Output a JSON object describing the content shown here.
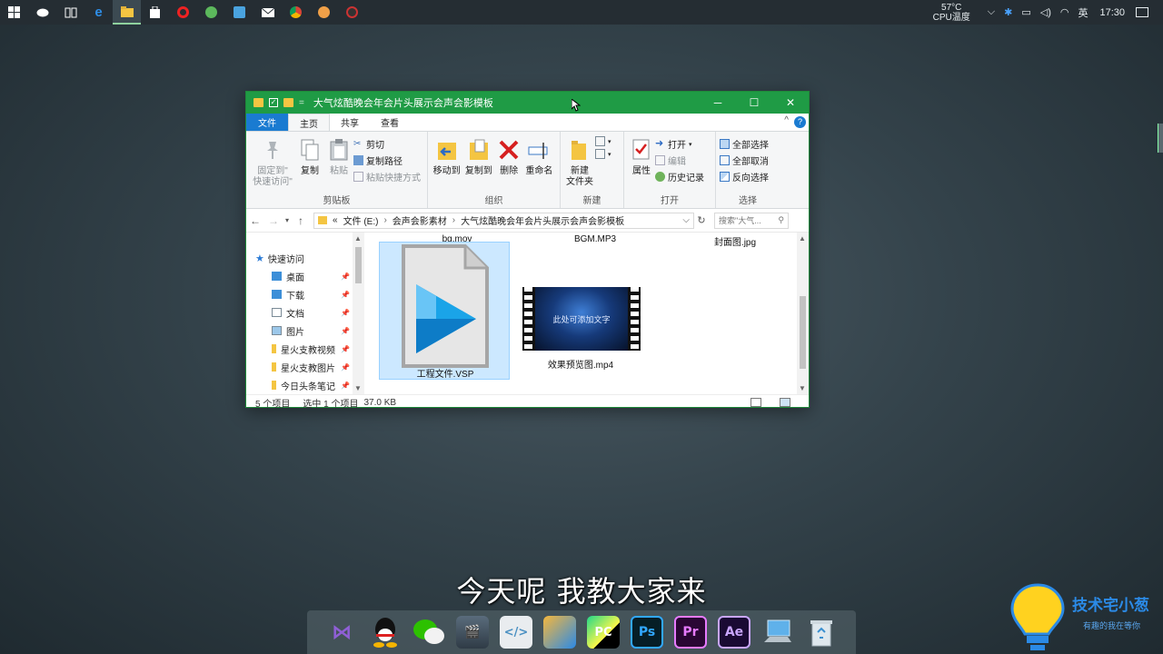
{
  "taskbar": {
    "tray": {
      "temperature": "57°C",
      "temperature_label": "CPU温度",
      "ime": "英",
      "time": "17:30"
    }
  },
  "window": {
    "title": "大气炫酷晚会年会片头展示会声会影模板",
    "ribbon_tabs": [
      "文件",
      "主页",
      "共享",
      "查看"
    ],
    "clipboard": {
      "pin_label_1": "固定到\"",
      "pin_label_2": "快速访问\"",
      "copy": "复制",
      "paste": "粘贴",
      "cut": "剪切",
      "copy_path": "复制路径",
      "paste_shortcut": "粘贴快捷方式",
      "group": "剪贴板"
    },
    "organize": {
      "move_to": "移动到",
      "copy_to": "复制到",
      "delete": "删除",
      "rename": "重命名",
      "group": "组织"
    },
    "new": {
      "new_folder_1": "新建",
      "new_folder_2": "文件夹",
      "group": "新建"
    },
    "open": {
      "properties": "属性",
      "open": "打开",
      "edit": "编辑",
      "history": "历史记录",
      "group": "打开"
    },
    "select": {
      "select_all": "全部选择",
      "select_none": "全部取消",
      "invert": "反向选择",
      "group": "选择"
    },
    "address": {
      "crumbs": [
        "文件 (E:)",
        "会声会影素材",
        "大气炫酷晚会年会片头展示会声会影模板"
      ],
      "overflow": "«",
      "search_placeholder": "搜索\"大气..."
    },
    "nav_pane": {
      "quick_access": "快速访问",
      "items": [
        "桌面",
        "下载",
        "文档",
        "图片",
        "星火支教视频",
        "星火支教图片",
        "今日头条笔记"
      ]
    },
    "files": {
      "top_row": [
        "bg.mov",
        "BGM.MP3",
        "封面图.jpg"
      ],
      "project_file": "工程文件.VSP",
      "preview_file": "效果预览图.mp4",
      "thumbnail_text": "此处可添加文字"
    },
    "status": {
      "count": "5 个项目",
      "selection": "选中 1 个项目",
      "size": "37.0 KB"
    }
  },
  "subtitle": "今天呢 我教大家来",
  "dock": {
    "apps": [
      "VS",
      "QQ",
      "WeChat",
      "Clapper",
      "Code",
      "Files",
      "PC",
      "Ps",
      "Pr",
      "Ae",
      "PC",
      "Bin"
    ]
  },
  "watermark": {
    "title": "技术宅小葱",
    "subtitle": "有趣的我在等你"
  },
  "colors": {
    "titlebar": "#1f9b45",
    "accent": "#1a7bd1",
    "selection": "#cce8ff"
  }
}
